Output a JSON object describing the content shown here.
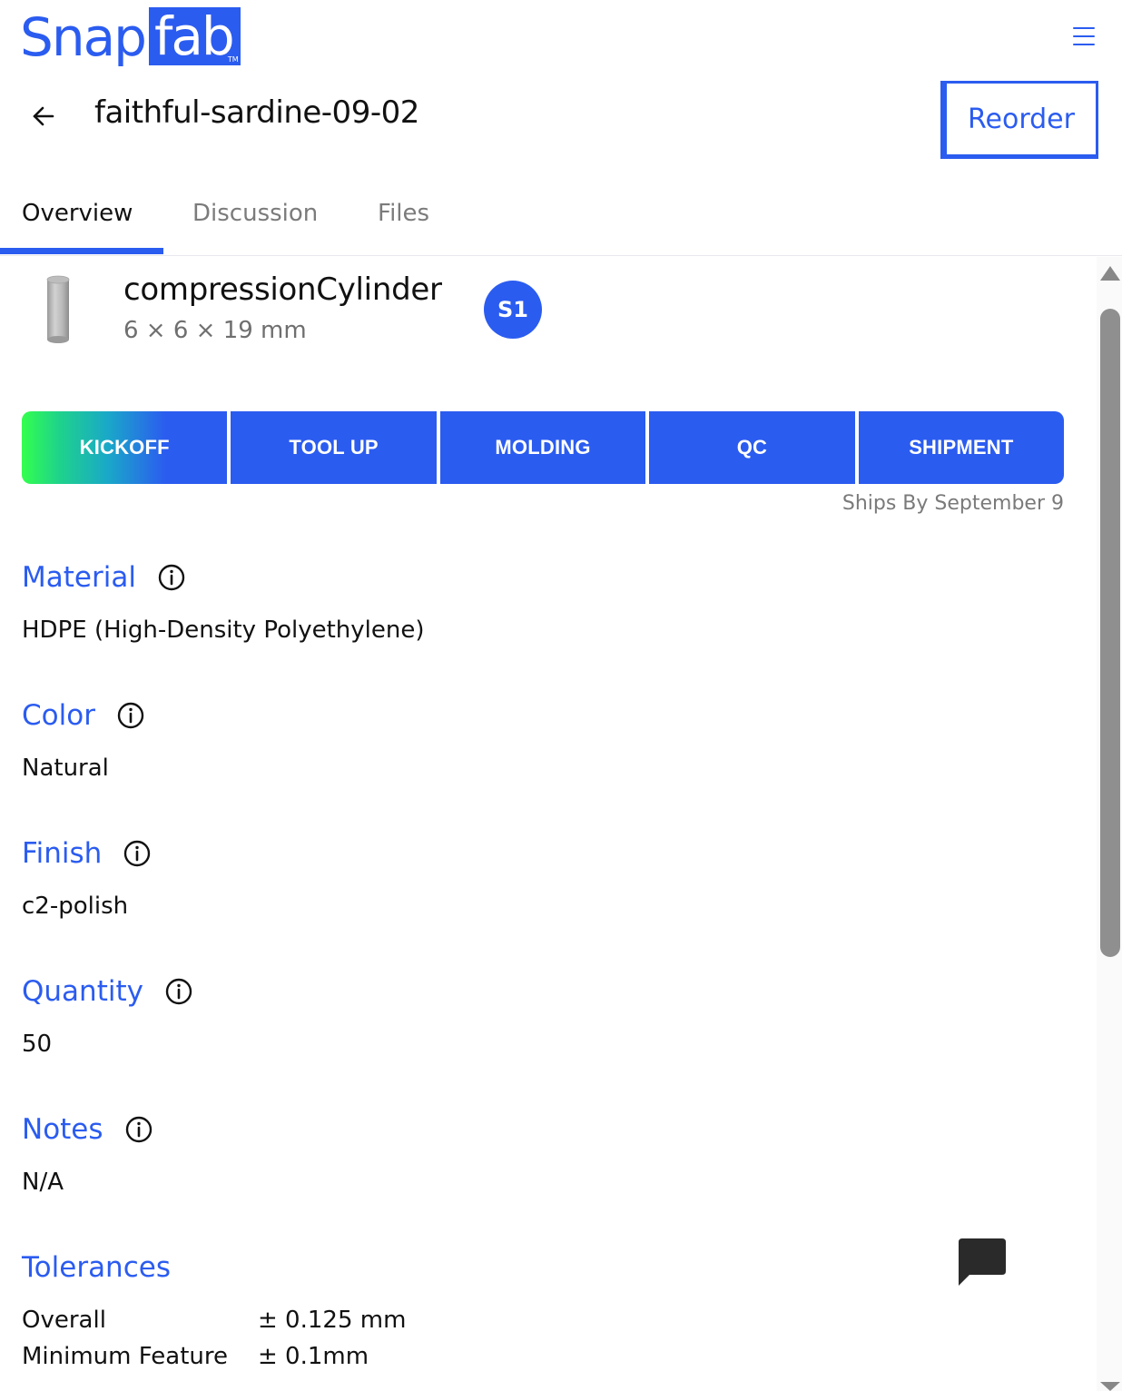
{
  "header": {
    "logo_left": "Snap",
    "logo_right": "fab",
    "logo_tm": "TM",
    "menu_icon": "hamburger-menu-icon",
    "back_icon": "arrow-left-icon",
    "title": "faithful-sardine-09-02",
    "reorder_label": "Reorder"
  },
  "tabs": [
    {
      "label": "Overview",
      "active": true
    },
    {
      "label": "Discussion",
      "active": false
    },
    {
      "label": "Files",
      "active": false
    }
  ],
  "part": {
    "name": "compressionCylinder",
    "dimensions": "6 × 6 × 19 mm",
    "badge": "S1"
  },
  "stages": {
    "items": [
      "KICKOFF",
      "TOOL UP",
      "MOLDING",
      "QC",
      "SHIPMENT"
    ],
    "current": "KICKOFF",
    "ships_by": "Ships By September 9"
  },
  "specs": {
    "material": {
      "label": "Material",
      "value": "HDPE (High-Density Polyethylene)"
    },
    "color": {
      "label": "Color",
      "value": "Natural"
    },
    "finish": {
      "label": "Finish",
      "value": "c2-polish"
    },
    "quantity": {
      "label": "Quantity",
      "value": "50"
    },
    "notes": {
      "label": "Notes",
      "value": "N/A"
    }
  },
  "tolerances": {
    "label": "Tolerances",
    "rows": [
      {
        "name": "Overall",
        "value": "± 0.125 mm"
      },
      {
        "name": "Minimum Feature",
        "value": "± 0.1mm"
      }
    ]
  },
  "colors": {
    "accent": "#2b5cf0",
    "gradient_start": "#33ff4d",
    "muted_text": "#7b7b7b",
    "scrollbar_thumb": "#8f8f8f"
  },
  "icons": {
    "info": "info-circle-icon",
    "chat": "chat-bubble-icon"
  }
}
